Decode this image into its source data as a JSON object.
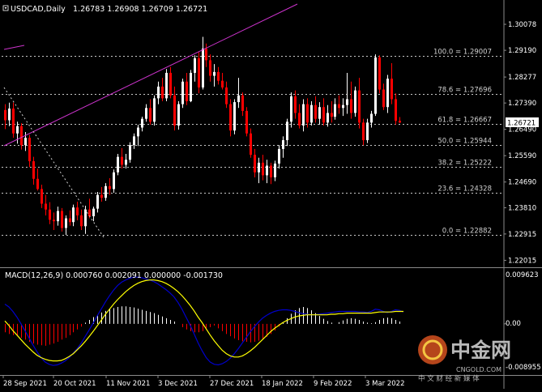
{
  "header": {
    "symbol_caption": "USDCAD,Daily",
    "ohlc_values": "1.26783 1.26908 1.26709 1.26721"
  },
  "current_price_label": "1.26721",
  "price_axis": {
    "ticks": [
      "1.30078",
      "1.29190",
      "1.28277",
      "1.27390",
      "1.26490",
      "1.25590",
      "1.24690",
      "1.23810",
      "1.22915",
      "1.22015"
    ]
  },
  "macd_panel": {
    "caption": "MACD(12,26,9) 0.000760 0.002091 0.000000 -0.001730",
    "axis_ticks": [
      "0.009623",
      "0.00",
      "-0.008955"
    ]
  },
  "fibonacci": [
    {
      "label": "100.0 = 1.29007",
      "price": 1.29007
    },
    {
      "label": "78.6 = 1.27696",
      "price": 1.27696
    },
    {
      "label": "61.8 = 1.26667",
      "price": 1.26667
    },
    {
      "label": "50.0 = 1.25944",
      "price": 1.25944
    },
    {
      "label": "38.2 = 1.25222",
      "price": 1.25222
    },
    {
      "label": "23.6 = 1.24328",
      "price": 1.24328
    },
    {
      "label": "0.0 = 1.22882",
      "price": 1.22882
    }
  ],
  "date_axis": [
    "28 Sep 2021",
    "20 Oct 2021",
    "11 Nov 2021",
    "3 Dec 2021",
    "27 Dec 2021",
    "18 Jan 2022",
    "9 Feb 2022",
    "3 Mar 2022"
  ],
  "watermark": {
    "brand": "中金网",
    "url": "CNGOLD.COM",
    "tagline": "中 文 财 经 新 媒 体"
  },
  "colors": {
    "up": "#ffffff",
    "down": "#ff0000",
    "fib": "#c8c8c8",
    "trend": "#cc33cc",
    "macd_line": "#0000cc",
    "signal_line": "#ffff00"
  },
  "chart_data": {
    "type": "candlestick",
    "price_range": [
      1.21805,
      1.30383
    ],
    "candles": [
      [
        1.2715,
        1.2735,
        1.265,
        1.268
      ],
      [
        1.268,
        1.274,
        1.266,
        1.272
      ],
      [
        1.272,
        1.274,
        1.262,
        1.2635
      ],
      [
        1.2635,
        1.2675,
        1.26,
        1.266
      ],
      [
        1.266,
        1.267,
        1.258,
        1.2595
      ],
      [
        1.2595,
        1.264,
        1.2575,
        1.262
      ],
      [
        1.262,
        1.263,
        1.252,
        1.254
      ],
      [
        1.254,
        1.2555,
        1.246,
        1.248
      ],
      [
        1.248,
        1.2515,
        1.244,
        1.2445
      ],
      [
        1.2445,
        1.246,
        1.238,
        1.2395
      ],
      [
        1.2395,
        1.2425,
        1.2355,
        1.2375
      ],
      [
        1.2375,
        1.24,
        1.2325,
        1.234
      ],
      [
        1.234,
        1.2365,
        1.2305,
        1.2335
      ],
      [
        1.2335,
        1.2385,
        1.232,
        1.237
      ],
      [
        1.237,
        1.238,
        1.23,
        1.2312
      ],
      [
        1.2312,
        1.2355,
        1.2288,
        1.2345
      ],
      [
        1.2345,
        1.2372,
        1.232,
        1.2332
      ],
      [
        1.2332,
        1.2392,
        1.2318,
        1.2382
      ],
      [
        1.2382,
        1.2402,
        1.2338,
        1.2355
      ],
      [
        1.2355,
        1.2375,
        1.2305,
        1.2318
      ],
      [
        1.2318,
        1.2388,
        1.2292,
        1.2375
      ],
      [
        1.2375,
        1.2412,
        1.2345,
        1.2352
      ],
      [
        1.2352,
        1.2385,
        1.2335,
        1.2378
      ],
      [
        1.2378,
        1.2435,
        1.2365,
        1.2425
      ],
      [
        1.2425,
        1.2452,
        1.2402,
        1.2415
      ],
      [
        1.2415,
        1.2465,
        1.2405,
        1.2455
      ],
      [
        1.2455,
        1.2482,
        1.2425,
        1.2445
      ],
      [
        1.2445,
        1.2512,
        1.2432,
        1.2502
      ],
      [
        1.2502,
        1.2565,
        1.2492,
        1.2555
      ],
      [
        1.2555,
        1.2585,
        1.2515,
        1.2528
      ],
      [
        1.2528,
        1.2565,
        1.2515,
        1.2545
      ],
      [
        1.2545,
        1.2605,
        1.2535,
        1.2595
      ],
      [
        1.2595,
        1.2635,
        1.2582,
        1.2625
      ],
      [
        1.2625,
        1.2665,
        1.2592,
        1.2655
      ],
      [
        1.2655,
        1.2692,
        1.2642,
        1.2685
      ],
      [
        1.2685,
        1.2735,
        1.2675,
        1.2722
      ],
      [
        1.2722,
        1.2752,
        1.2665,
        1.2675
      ],
      [
        1.2675,
        1.2765,
        1.2662,
        1.2755
      ],
      [
        1.2755,
        1.2812,
        1.2735,
        1.2795
      ],
      [
        1.2795,
        1.2825,
        1.2745,
        1.2755
      ],
      [
        1.2755,
        1.2855,
        1.2745,
        1.2842
      ],
      [
        1.2842,
        1.2862,
        1.2755,
        1.2765
      ],
      [
        1.2765,
        1.2795,
        1.2645,
        1.2662
      ],
      [
        1.2662,
        1.2745,
        1.2648,
        1.2735
      ],
      [
        1.2735,
        1.2822,
        1.2722,
        1.2812
      ],
      [
        1.2812,
        1.2842,
        1.2732,
        1.2745
      ],
      [
        1.2745,
        1.2852,
        1.2742,
        1.2842
      ],
      [
        1.2842,
        1.2902,
        1.2812,
        1.2892
      ],
      [
        1.2892,
        1.2912,
        1.2772,
        1.2792
      ],
      [
        1.2792,
        1.2965,
        1.2785,
        1.2925
      ],
      [
        1.2925,
        1.2942,
        1.2862,
        1.2885
      ],
      [
        1.2885,
        1.2905,
        1.2812,
        1.2832
      ],
      [
        1.2832,
        1.2872,
        1.2795,
        1.2845
      ],
      [
        1.2845,
        1.2862,
        1.2802,
        1.2815
      ],
      [
        1.2815,
        1.2842,
        1.2785,
        1.2792
      ],
      [
        1.2792,
        1.2812,
        1.2722,
        1.2735
      ],
      [
        1.2735,
        1.2752,
        1.2625,
        1.2645
      ],
      [
        1.2645,
        1.2752,
        1.2632,
        1.2742
      ],
      [
        1.2742,
        1.2825,
        1.2722,
        1.2765
      ],
      [
        1.2765,
        1.2775,
        1.2695,
        1.2712
      ],
      [
        1.2712,
        1.2725,
        1.2625,
        1.2635
      ],
      [
        1.2635,
        1.2652,
        1.2552,
        1.2562
      ],
      [
        1.2562,
        1.2582,
        1.2485,
        1.2502
      ],
      [
        1.2502,
        1.2552,
        1.2465,
        1.2535
      ],
      [
        1.2535,
        1.2562,
        1.2475,
        1.2492
      ],
      [
        1.2492,
        1.2545,
        1.2465,
        1.2525
      ],
      [
        1.2525,
        1.2535,
        1.2462,
        1.2485
      ],
      [
        1.2485,
        1.2542,
        1.2472,
        1.2532
      ],
      [
        1.2532,
        1.2595,
        1.2515,
        1.2582
      ],
      [
        1.2582,
        1.2625,
        1.2552,
        1.2612
      ],
      [
        1.2612,
        1.2685,
        1.2592,
        1.2675
      ],
      [
        1.2675,
        1.2775,
        1.2655,
        1.2762
      ],
      [
        1.2762,
        1.2782,
        1.2685,
        1.2705
      ],
      [
        1.2705,
        1.2735,
        1.2652,
        1.2662
      ],
      [
        1.2662,
        1.2752,
        1.2642,
        1.2735
      ],
      [
        1.2735,
        1.2755,
        1.2655,
        1.2672
      ],
      [
        1.2672,
        1.2745,
        1.2662,
        1.2732
      ],
      [
        1.2732,
        1.2762,
        1.2672,
        1.2685
      ],
      [
        1.2685,
        1.2742,
        1.2665,
        1.2725
      ],
      [
        1.2725,
        1.2755,
        1.2662,
        1.2672
      ],
      [
        1.2672,
        1.2732,
        1.2658,
        1.2705
      ],
      [
        1.2705,
        1.2745,
        1.2672,
        1.2692
      ],
      [
        1.2692,
        1.2755,
        1.2682,
        1.2735
      ],
      [
        1.2735,
        1.2765,
        1.2702,
        1.2722
      ],
      [
        1.2722,
        1.2755,
        1.2695,
        1.2732
      ],
      [
        1.2732,
        1.2842,
        1.2702,
        1.2752
      ],
      [
        1.2752,
        1.2812,
        1.2685,
        1.2705
      ],
      [
        1.2705,
        1.2795,
        1.2692,
        1.2782
      ],
      [
        1.2782,
        1.2825,
        1.2652,
        1.2672
      ],
      [
        1.2672,
        1.2685,
        1.2595,
        1.2612
      ],
      [
        1.2612,
        1.2685,
        1.2602,
        1.2672
      ],
      [
        1.2672,
        1.2712,
        1.2655,
        1.2702
      ],
      [
        1.2702,
        1.2905,
        1.2695,
        1.2895
      ],
      [
        1.2895,
        1.2902,
        1.2772,
        1.2785
      ],
      [
        1.2785,
        1.2805,
        1.2715,
        1.2725
      ],
      [
        1.2725,
        1.2835,
        1.2705,
        1.2822
      ],
      [
        1.2822,
        1.2875,
        1.2735,
        1.2752
      ],
      [
        1.2752,
        1.2772,
        1.2665,
        1.2678
      ],
      [
        1.2678,
        1.2691,
        1.2671,
        1.2672
      ]
    ],
    "fib_anchor_low": 1.22882,
    "fib_anchor_high": 1.29007,
    "macd": {
      "range": [
        -0.008955,
        0.009623
      ],
      "histogram": [
        -0.0015,
        -0.0018,
        -0.002,
        -0.0022,
        -0.0025,
        -0.0028,
        -0.0032,
        -0.0035,
        -0.0037,
        -0.0038,
        -0.0039,
        -0.0037,
        -0.0035,
        -0.0032,
        -0.0028,
        -0.0025,
        -0.002,
        -0.0015,
        -0.001,
        -0.0005,
        0.0002,
        0.0007,
        0.0012,
        0.0016,
        0.002,
        0.0023,
        0.0026,
        0.0028,
        0.003,
        0.0031,
        0.0031,
        0.003,
        0.0029,
        0.0027,
        0.0025,
        0.0023,
        0.0021,
        0.0019,
        0.0016,
        0.0013,
        0.001,
        0.0007,
        0.0004,
        0.0,
        -0.0006,
        -0.001,
        -0.0013,
        -0.0015,
        -0.0015,
        -0.0013,
        -0.001,
        -0.0006,
        -0.0003,
        -0.0008,
        -0.0013,
        -0.0018,
        -0.0022,
        -0.0026,
        -0.0029,
        -0.0031,
        -0.0032,
        -0.0033,
        -0.0032,
        -0.003,
        -0.0027,
        -0.0023,
        -0.0018,
        -0.0012,
        -0.0005,
        0.0002,
        0.001,
        0.0018,
        0.0024,
        0.0028,
        0.003,
        0.0028,
        0.0024,
        0.0019,
        0.0014,
        0.0009,
        0.0005,
        0.0002,
        0.0,
        0.0003,
        0.0006,
        0.0009,
        0.001,
        0.0009,
        0.0007,
        0.0004,
        0.0002,
        0.0001,
        0.0003,
        0.0007,
        0.001,
        0.0011,
        0.001,
        0.0007,
        0.0004,
        0.0
      ],
      "macd_line": [
        0.0035,
        0.003,
        0.0022,
        0.0012,
        0.0,
        -0.0012,
        -0.0025,
        -0.0038,
        -0.005,
        -0.006,
        -0.0068,
        -0.0072,
        -0.0074,
        -0.0073,
        -0.007,
        -0.0066,
        -0.006,
        -0.0052,
        -0.0044,
        -0.0034,
        -0.0022,
        -0.001,
        0.0002,
        0.0015,
        0.0027,
        0.0039,
        0.005,
        0.006,
        0.0068,
        0.0074,
        0.0078,
        0.0081,
        0.0083,
        0.0083,
        0.0082,
        0.008,
        0.0078,
        0.0075,
        0.0071,
        0.0066,
        0.0061,
        0.0055,
        0.0048,
        0.0038,
        0.0026,
        0.0012,
        -0.0002,
        -0.0018,
        -0.0034,
        -0.0048,
        -0.006,
        -0.0068,
        -0.0072,
        -0.0073,
        -0.0071,
        -0.0067,
        -0.0061,
        -0.0053,
        -0.0044,
        -0.0034,
        -0.0024,
        -0.0014,
        -0.0005,
        0.0003,
        0.001,
        0.0015,
        0.0019,
        0.0022,
        0.0024,
        0.0025,
        0.0025,
        0.0024,
        0.0022,
        0.002,
        0.0018,
        0.0017,
        0.0016,
        0.0016,
        0.0017,
        0.0018,
        0.0019,
        0.002,
        0.0021,
        0.0022,
        0.0022,
        0.0022,
        0.0022,
        0.0022,
        0.0021,
        0.0021,
        0.002,
        0.0022,
        0.0026,
        0.0025,
        0.0022,
        0.002,
        0.0022,
        0.0025,
        0.0024,
        0.0021
      ],
      "signal_line": [
        0.0005,
        -0.0003,
        -0.0012,
        -0.002,
        -0.0028,
        -0.0036,
        -0.0043,
        -0.005,
        -0.0056,
        -0.006,
        -0.0063,
        -0.0065,
        -0.0066,
        -0.0066,
        -0.0065,
        -0.0062,
        -0.0058,
        -0.0053,
        -0.0046,
        -0.0039,
        -0.0031,
        -0.0022,
        -0.0013,
        -0.0003,
        0.0007,
        0.0017,
        0.0026,
        0.0035,
        0.0043,
        0.005,
        0.0057,
        0.0063,
        0.0068,
        0.0072,
        0.0075,
        0.0077,
        0.0078,
        0.0078,
        0.0077,
        0.0075,
        0.0072,
        0.0068,
        0.0063,
        0.0057,
        0.005,
        0.0042,
        0.0033,
        0.0023,
        0.0012,
        0.0002,
        -0.0009,
        -0.002,
        -0.003,
        -0.0039,
        -0.0047,
        -0.0053,
        -0.0057,
        -0.0059,
        -0.0059,
        -0.0057,
        -0.0053,
        -0.0048,
        -0.0042,
        -0.0035,
        -0.0028,
        -0.0021,
        -0.0014,
        -0.0008,
        -0.0003,
        0.0002,
        0.0006,
        0.0009,
        0.0012,
        0.0014,
        0.0015,
        0.0016,
        0.0016,
        0.0016,
        0.0016,
        0.0016,
        0.0016,
        0.0017,
        0.0017,
        0.0018,
        0.0018,
        0.0019,
        0.0019,
        0.0019,
        0.0019,
        0.0019,
        0.0019,
        0.0019,
        0.002,
        0.0021,
        0.0021,
        0.0021,
        0.0021,
        0.0022,
        0.0022,
        0.0022
      ]
    }
  }
}
